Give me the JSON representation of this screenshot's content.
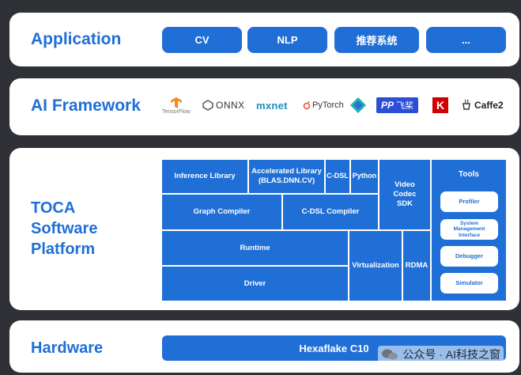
{
  "application": {
    "title": "Application",
    "items": [
      "CV",
      "NLP",
      "推荐系统",
      "..."
    ]
  },
  "framework": {
    "title": "AI Framework",
    "logos": {
      "tensorflow": "TensorFlow",
      "onnx": "ONNX",
      "mxnet": "mxnet",
      "pytorch": "PyTorch",
      "paddle": "飞桨",
      "keras": "K",
      "caffe2": "Caffe2"
    }
  },
  "platform": {
    "title_lines": [
      "TOCA",
      "Software",
      "Platform"
    ],
    "inference_library": "Inference Library",
    "accelerated_library": "Accelerated Library (BLAS.DNN.CV)",
    "cdsl": "C-DSL",
    "python": "Python",
    "video_codec": "Video Codec SDK",
    "graph_compiler": "Graph Compiler",
    "cdsl_compiler": "C-DSL Compiler",
    "runtime": "Runtime",
    "driver": "Driver",
    "virtualization": "Virtualization",
    "rdma": "RDMA",
    "tools": {
      "title": "Tools",
      "items": [
        "Profiler",
        "System Management Interface",
        "Debugger",
        "Simulator"
      ]
    }
  },
  "hardware": {
    "title": "Hardware",
    "chip": "Hexaflake C10"
  },
  "watermark": "公众号 · AI科技之窗",
  "colors": {
    "primary": "#1f6fd6",
    "background": "#2f3136",
    "panel": "#ffffff"
  }
}
